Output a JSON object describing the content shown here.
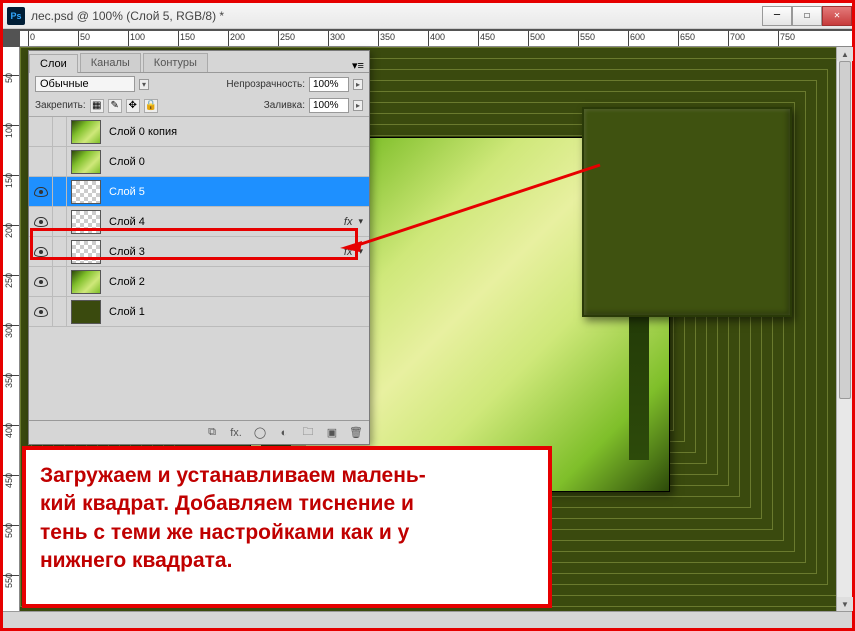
{
  "window": {
    "title": "лес.psd @ 100% (Слой 5, RGB/8) *",
    "min": "─",
    "max": "☐",
    "close": "✕"
  },
  "ruler_h": [
    "0",
    "50",
    "100",
    "150",
    "200",
    "250",
    "300",
    "350",
    "400",
    "450",
    "500",
    "550",
    "600",
    "650",
    "700",
    "750"
  ],
  "ruler_v": [
    "50",
    "100",
    "150",
    "200",
    "250",
    "300",
    "350",
    "400",
    "450",
    "500",
    "550"
  ],
  "panel": {
    "tabs": {
      "layers": "Слои",
      "channels": "Каналы",
      "paths": "Контуры"
    },
    "menu": "▾≡",
    "blend_mode": "Обычные",
    "blend_arrow": "▾",
    "opacity_label": "Непрозрачность:",
    "opacity_value": "100%",
    "lock_label": "Закрепить:",
    "fill_label": "Заливка:",
    "fill_value": "100%",
    "lock_icons": {
      "trans": "▦",
      "brush": "✎",
      "move": "✥",
      "all": "🔒"
    },
    "footer": {
      "link": "⧉",
      "fx": "fx.",
      "mask": "◯",
      "adjust": "◐",
      "group": "🗀",
      "new": "▣",
      "trash": "🗑"
    }
  },
  "layers": [
    {
      "visible": false,
      "thumb": "forest",
      "name": "Слой 0 копия",
      "fx": false,
      "selected": false
    },
    {
      "visible": false,
      "thumb": "forest",
      "name": "Слой 0",
      "fx": false,
      "selected": false
    },
    {
      "visible": true,
      "thumb": "checker",
      "name": "Слой 5",
      "fx": false,
      "selected": true
    },
    {
      "visible": true,
      "thumb": "checker",
      "name": "Слой 4",
      "fx": true,
      "selected": false
    },
    {
      "visible": true,
      "thumb": "checker",
      "name": "Слой 3",
      "fx": true,
      "selected": false
    },
    {
      "visible": true,
      "thumb": "forest",
      "name": "Слой 2",
      "fx": false,
      "selected": false
    },
    {
      "visible": true,
      "thumb": "solid",
      "name": "Слой 1",
      "fx": false,
      "selected": false
    }
  ],
  "fx_label": "fx",
  "fx_arrow": "▾",
  "annotation": "Загружаем и устанавливаем малень-\nкий квадрат. Добавляем тиснение и\nтень с теми же настройками как и у\nнижнего квадрата."
}
